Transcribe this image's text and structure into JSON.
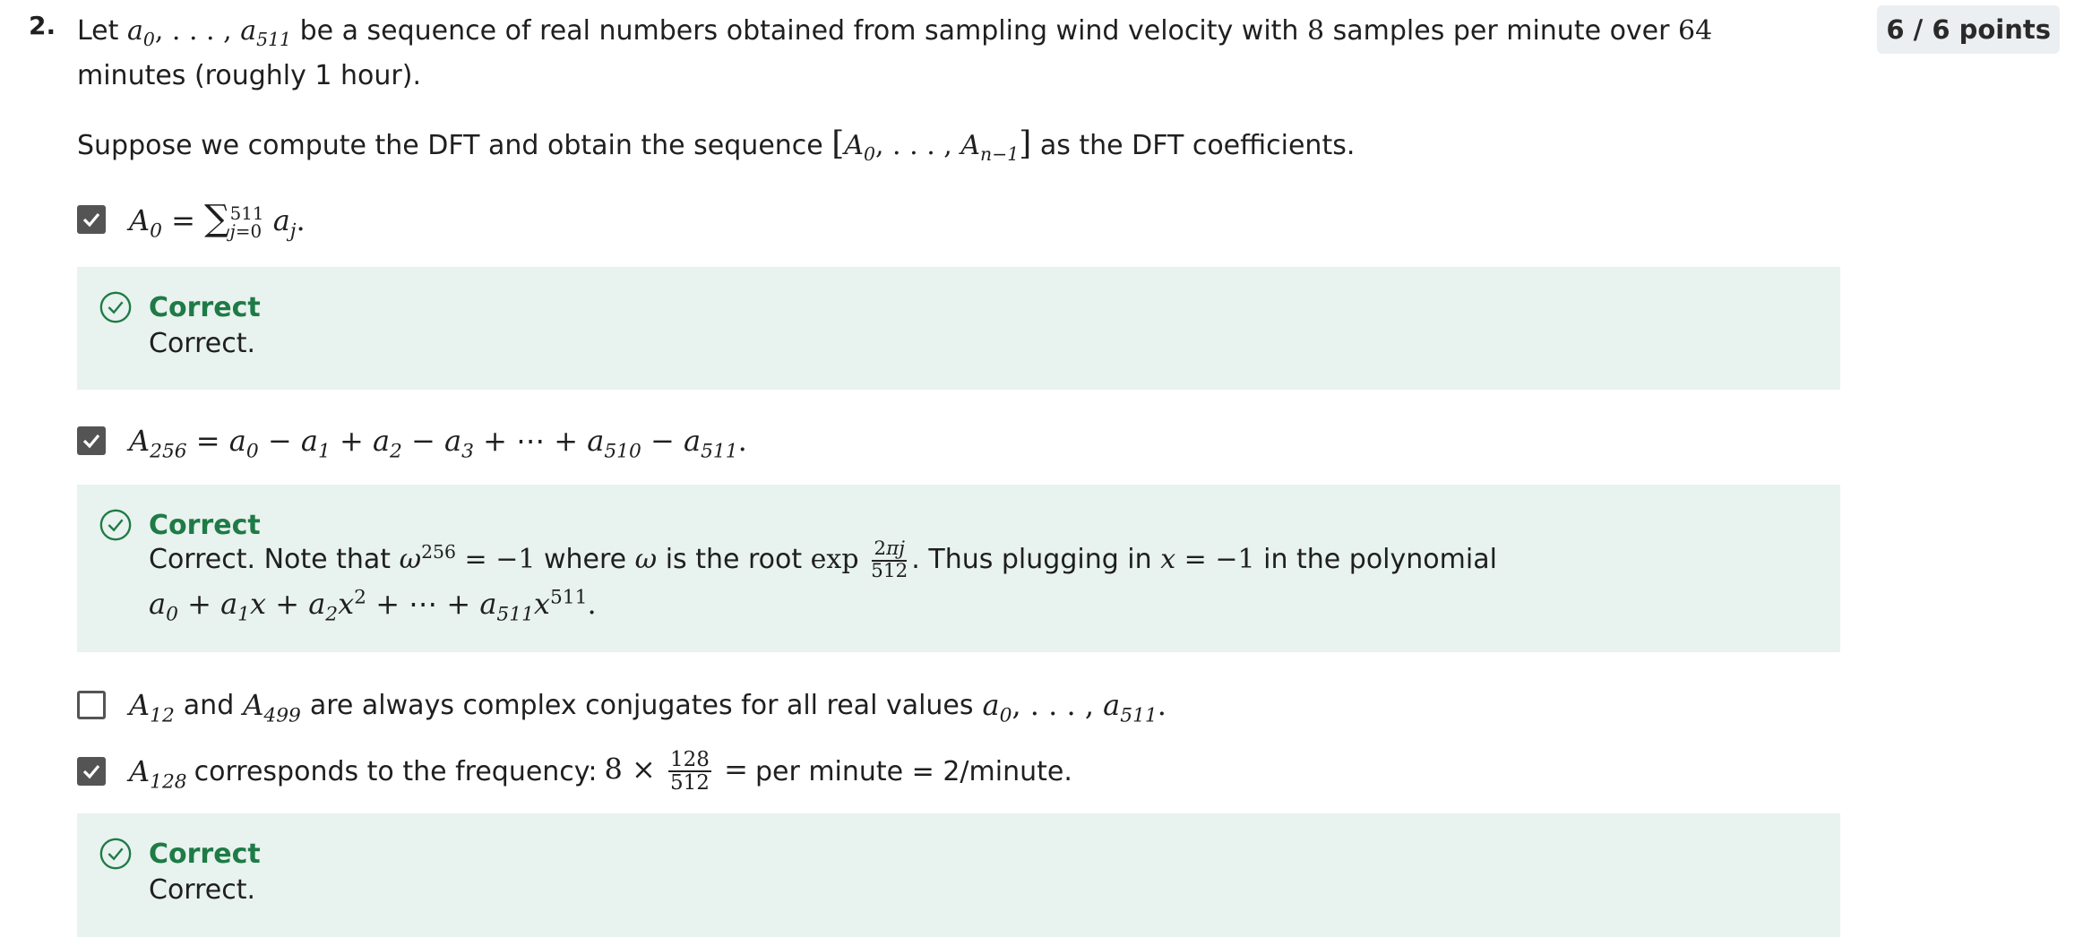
{
  "question": {
    "number": "2.",
    "points": "6 / 6 points",
    "text": {
      "t1": "Let",
      "t2": "be a sequence of real numbers obtained from sampling wind velocity with",
      "t3": "samples per minute over",
      "t4": "minutes (roughly 1 hour).",
      "n_samples": "8",
      "n_minutes": "64"
    },
    "intro": {
      "before": "Suppose we compute the DFT and obtain the sequence",
      "after": "as the DFT coefficients."
    }
  },
  "options": [
    {
      "checked": true,
      "label": "A0 = sum_{j=0}^{511} a_j."
    },
    {
      "checked": true,
      "label": "A256 = a0 - a1 + a2 - a3 + ... + a510 - a511."
    },
    {
      "checked": false,
      "t_and": "and",
      "t_rest": "are always complex conjugates for all real values"
    },
    {
      "checked": true,
      "t1": "corresponds to the frequency:",
      "t2": "per minute = 2/minute."
    }
  ],
  "feedback": [
    {
      "title": "Correct",
      "body": "Correct."
    },
    {
      "title": "Correct",
      "p1": "Correct. Note that",
      "p2": "where",
      "p3": "is the root",
      "p4": ". Thus plugging in",
      "p5": "in the polynomial"
    },
    {
      "title": "Correct",
      "body": "Correct."
    }
  ]
}
